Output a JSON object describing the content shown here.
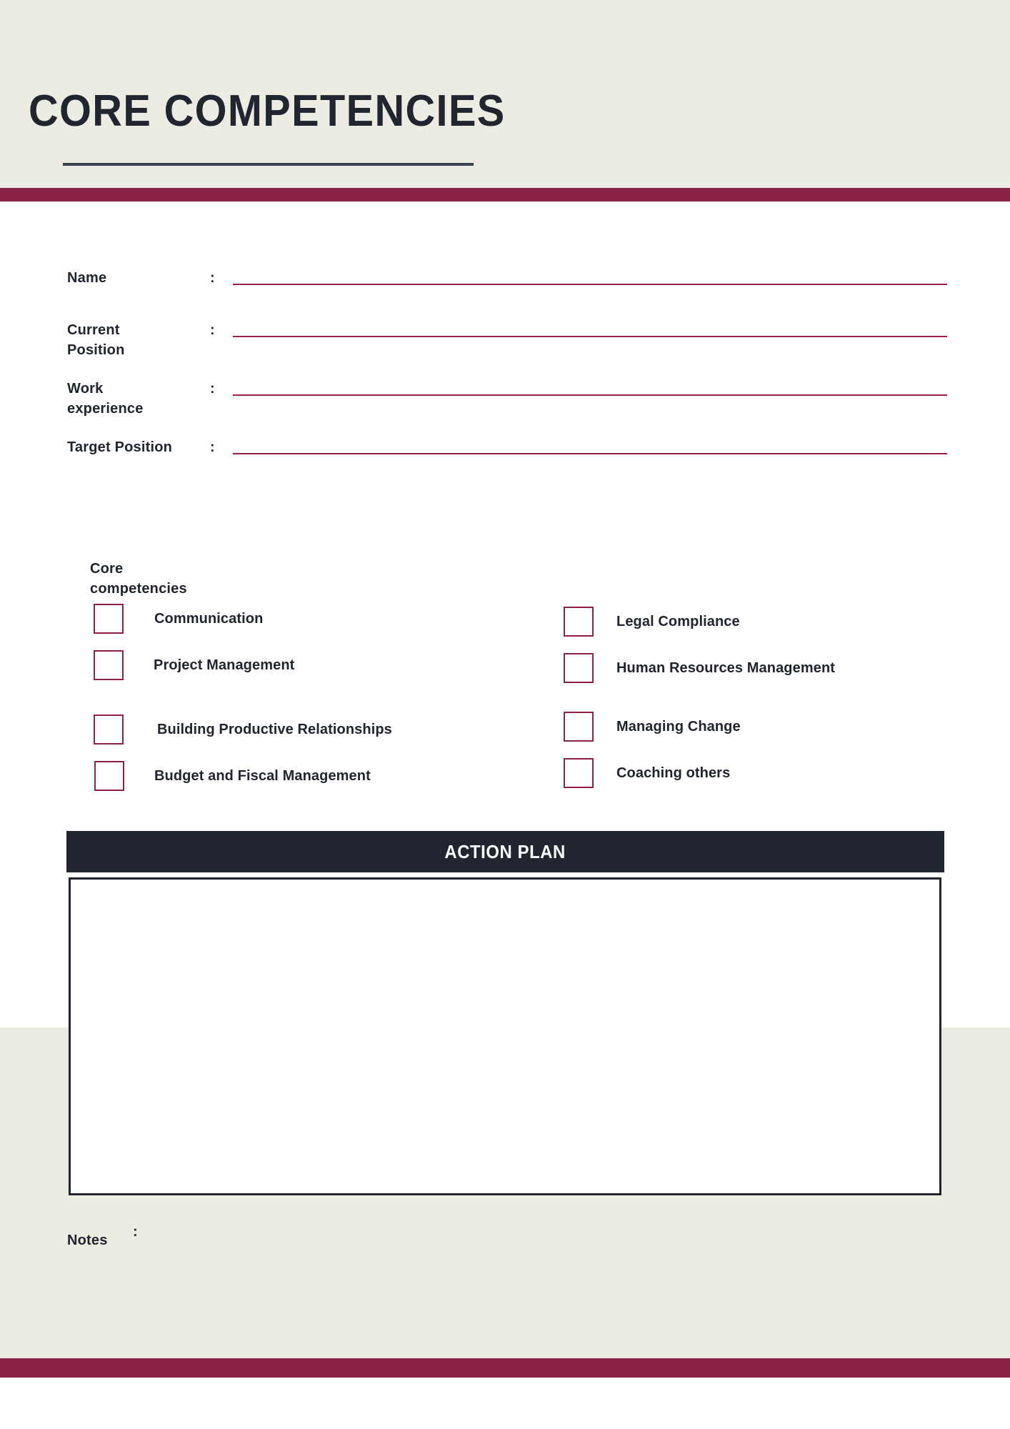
{
  "document": {
    "title": "CORE COMPETENCIES"
  },
  "colors": {
    "beige": "#edece3",
    "maroon": "#892246",
    "accent_line": "#9c2149",
    "checkbox_border": "#8f2145",
    "dark_navy": "#20252f",
    "white": "#ffffff"
  },
  "form": {
    "colon": ":",
    "fields": [
      {
        "label": "Name"
      },
      {
        "label": "Current\nPosition"
      },
      {
        "label": "Work\nexperience"
      },
      {
        "label": "Target Position"
      }
    ]
  },
  "competencies": {
    "heading": "Core\ncompetencies",
    "left_column": [
      {
        "label": "Communication",
        "checked": false
      },
      {
        "label": "Project Management",
        "checked": false
      },
      {
        "label": "Building Productive Relationships",
        "checked": false
      },
      {
        "label": "Budget and Fiscal Management",
        "checked": false
      }
    ],
    "right_column": [
      {
        "label": "Legal Compliance",
        "checked": false
      },
      {
        "label": "Human Resources Management",
        "checked": false
      },
      {
        "label": "Managing Change",
        "checked": false
      },
      {
        "label": "Coaching others",
        "checked": false
      }
    ]
  },
  "action_plan": {
    "header": "ACTION PLAN",
    "content": ""
  },
  "notes": {
    "label": "Notes",
    "colon": ":",
    "content": ""
  }
}
